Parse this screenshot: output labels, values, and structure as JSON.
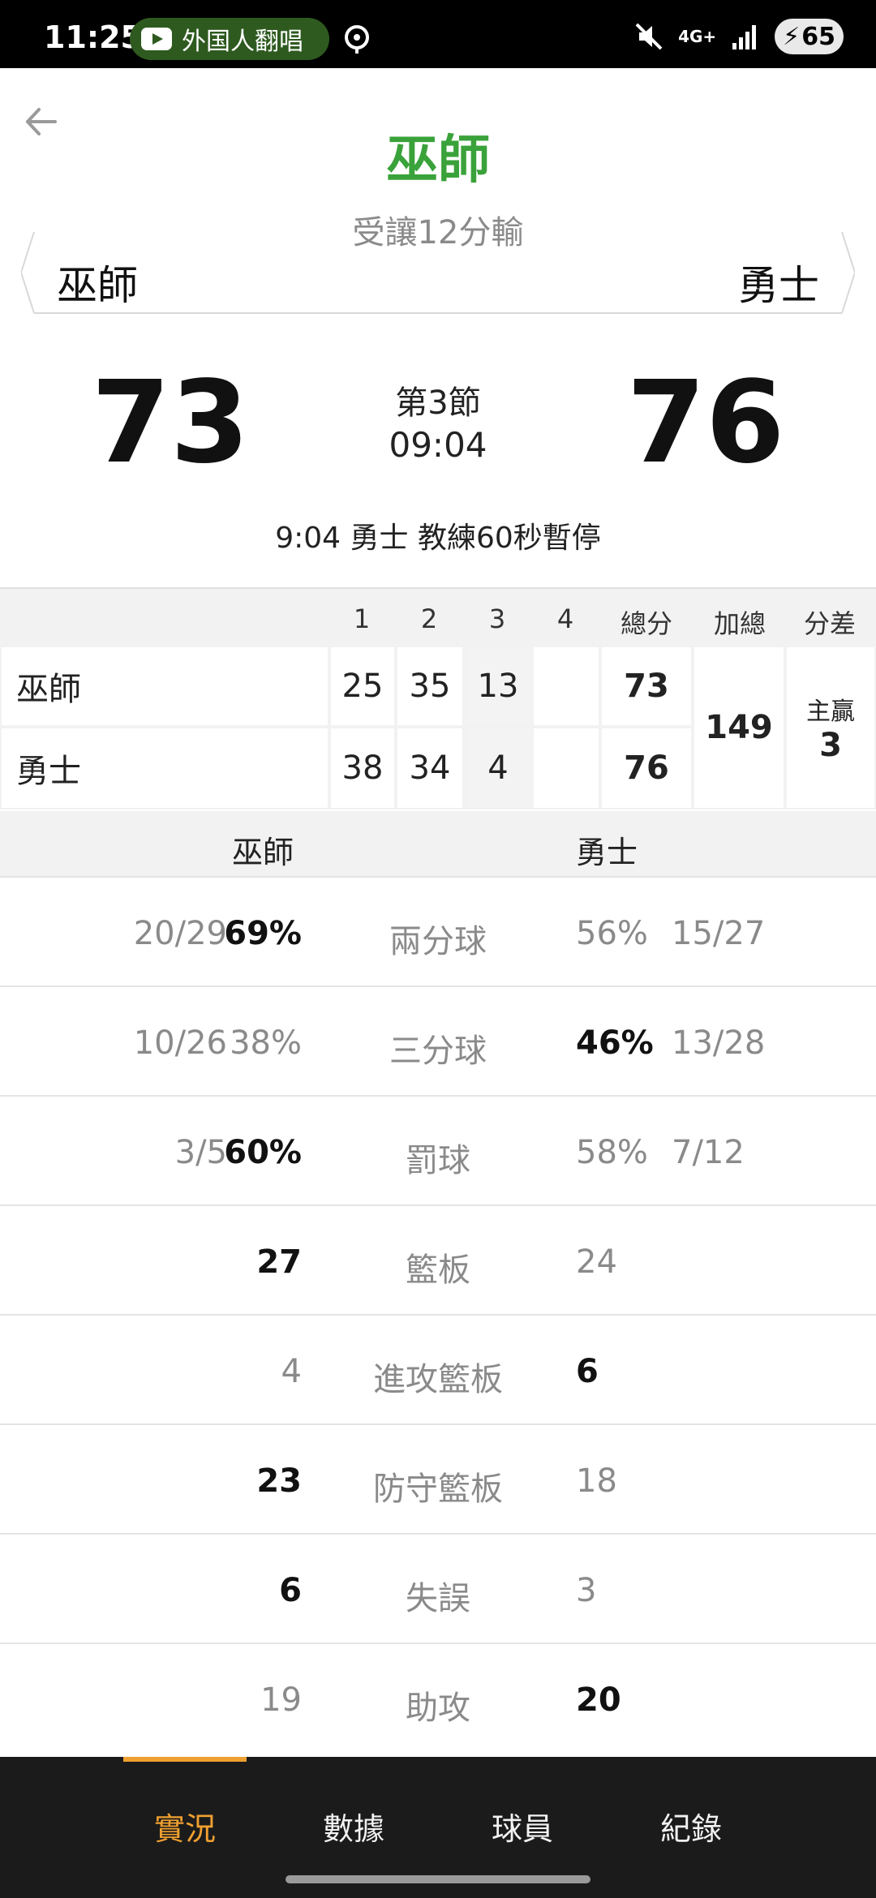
{
  "status_bar": {
    "time": "11:25",
    "media_text": "外国人翻唱",
    "network": "4G+",
    "battery": "65"
  },
  "header": {
    "title": "巫師",
    "handicap": "受讓12分輸",
    "away_team": "巫師",
    "home_team": "勇士"
  },
  "scoreboard": {
    "away_score": "73",
    "home_score": "76",
    "period": "第3節",
    "clock": "09:04",
    "last_play": "9:04 勇士  教練60秒暫停"
  },
  "quarters": {
    "headers": [
      "1",
      "2",
      "3",
      "4",
      "總分",
      "加總",
      "分差"
    ],
    "rows": [
      {
        "team": "巫師",
        "q1": "25",
        "q2": "35",
        "q3": "13",
        "q4": "",
        "total": "73"
      },
      {
        "team": "勇士",
        "q1": "38",
        "q2": "34",
        "q3": "4",
        "q4": "",
        "total": "76"
      }
    ],
    "sum_total": "149",
    "diff_label": "主贏",
    "diff_value": "3"
  },
  "stats": {
    "away_header": "巫師",
    "home_header": "勇士",
    "rows": [
      {
        "label": "兩分球",
        "away_frac": "20/29",
        "away": "69%",
        "home": "56%",
        "home_frac": "15/27",
        "leader": "away"
      },
      {
        "label": "三分球",
        "away_frac": "10/26",
        "away": "38%",
        "home": "46%",
        "home_frac": "13/28",
        "leader": "home"
      },
      {
        "label": "罰球",
        "away_frac": "3/5",
        "away": "60%",
        "home": "58%",
        "home_frac": "7/12",
        "leader": "away"
      },
      {
        "label": "籃板",
        "away_frac": "",
        "away": "27",
        "home": "24",
        "home_frac": "",
        "leader": "away"
      },
      {
        "label": "進攻籃板",
        "away_frac": "",
        "away": "4",
        "home": "6",
        "home_frac": "",
        "leader": "home"
      },
      {
        "label": "防守籃板",
        "away_frac": "",
        "away": "23",
        "home": "18",
        "home_frac": "",
        "leader": "away"
      },
      {
        "label": "失誤",
        "away_frac": "",
        "away": "6",
        "home": "3",
        "home_frac": "",
        "leader": "away"
      },
      {
        "label": "助攻",
        "away_frac": "",
        "away": "19",
        "home": "20",
        "home_frac": "",
        "leader": "home"
      }
    ]
  },
  "nav": {
    "tabs": [
      "實況",
      "數據",
      "球員",
      "紀錄"
    ],
    "active": "實況"
  },
  "colors": {
    "title_green": "#3aa23a",
    "accent_orange": "#f0a030"
  }
}
